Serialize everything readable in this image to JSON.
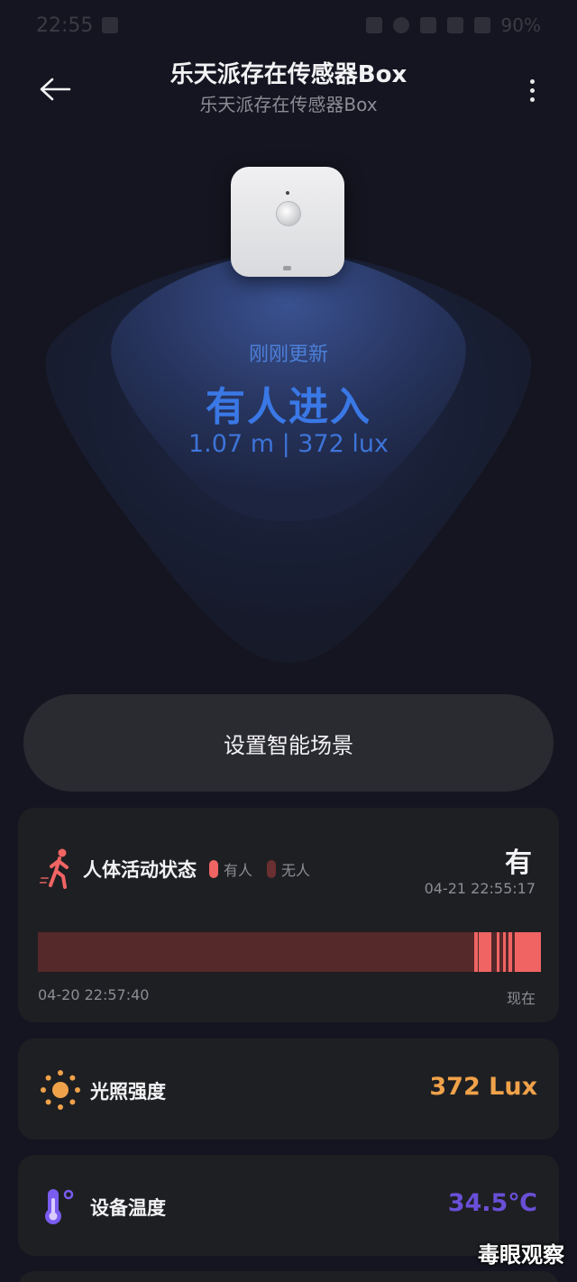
{
  "status_bar": {
    "time": "22:55",
    "battery": "90%"
  },
  "header": {
    "title": "乐天派存在传感器Box",
    "subtitle": "乐天派存在传感器Box",
    "back_icon": "arrow-left-icon",
    "more_icon": "more-vertical-icon"
  },
  "hero": {
    "update_label": "刚刚更新",
    "state": "有人进入",
    "metrics": "1.07  m | 372 lux"
  },
  "scene_button": {
    "label": "设置智能场景"
  },
  "activity_card": {
    "title": "人体活动状态",
    "legend_present": "有人",
    "legend_absent": "无人",
    "value": "有",
    "timestamp": "04-21 22:55:17",
    "start_time": "04-20 22:57:40",
    "end_time": "现在",
    "present_color": "#f06464",
    "absent_color": "#55282a",
    "present_segments": [
      {
        "from": 0.868,
        "to": 0.874
      },
      {
        "from": 0.876,
        "to": 0.902
      },
      {
        "from": 0.912,
        "to": 0.918
      },
      {
        "from": 0.924,
        "to": 0.93
      },
      {
        "from": 0.936,
        "to": 0.942
      },
      {
        "from": 0.948,
        "to": 1.0
      }
    ]
  },
  "light_card": {
    "label": "光照强度",
    "value": "372 Lux",
    "color": "#f0a24a",
    "icon": "sun-icon"
  },
  "temp_card": {
    "label": "设备温度",
    "value": "34.5℃",
    "color": "#6a4fd8",
    "icon": "thermometer-icon"
  },
  "watermark": "毒眼观察"
}
